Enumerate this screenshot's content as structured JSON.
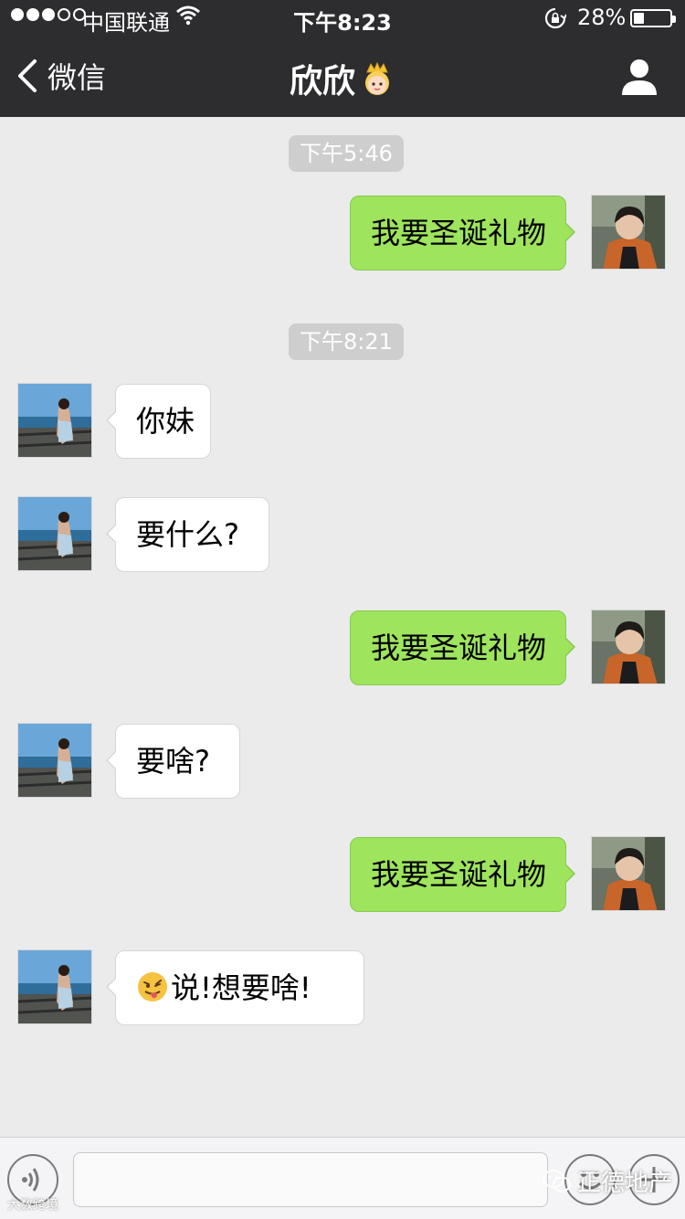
{
  "status_bar": {
    "carrier": "中国联通",
    "time": "下午8:23",
    "battery_percent": "28%",
    "battery_level": 0.28,
    "signal_bars_filled": 3,
    "signal_bars_total": 5
  },
  "nav": {
    "back_label": "微信",
    "title": "欣欣",
    "title_emoji_icon": "princess-face-icon",
    "profile_icon": "person-icon"
  },
  "chat": {
    "timestamps": [
      "下午5:46",
      "下午8:21"
    ],
    "messages": [
      {
        "from": "me",
        "text": "我要圣诞礼物"
      },
      {
        "from": "friend",
        "text": "你妹"
      },
      {
        "from": "friend",
        "text": "要什么?"
      },
      {
        "from": "me",
        "text": "我要圣诞礼物"
      },
      {
        "from": "friend",
        "text": "要啥?"
      },
      {
        "from": "me",
        "text": "我要圣诞礼物"
      },
      {
        "from": "friend",
        "emoji_icon": "tongue-out-face-icon",
        "text": "说!想要啥!"
      }
    ]
  },
  "input_bar": {
    "voice_icon": "voice-icon",
    "emoji_icon": "smiley-icon",
    "plus_icon": "plus-icon",
    "text_value": ""
  },
  "watermark": {
    "text": "正德地产",
    "bottom_left_text": "大数跨境"
  },
  "colors": {
    "nav_background": "#2d2d30",
    "chat_background": "#ebebeb",
    "my_bubble": "#9ee45d",
    "friend_bubble": "#ffffff",
    "timestamp_pill": "#cecece"
  }
}
